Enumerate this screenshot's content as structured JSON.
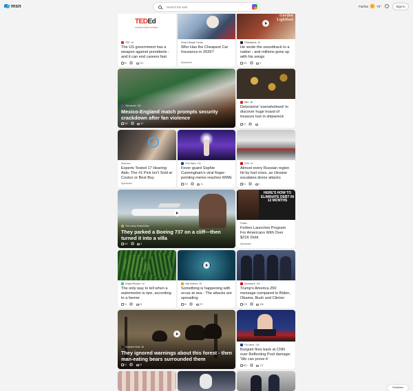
{
  "header": {
    "logo_text": "msn",
    "search_placeholder": "Search the web",
    "weather_city": "Fairfax",
    "weather_temp": "75°",
    "signin_label": "Sign in"
  },
  "feedback_label": "Feedback",
  "cards": [
    {
      "source": "TED",
      "time": "2d",
      "title": "The US government has a weapon against presidents - and it can end careers fast",
      "likes": "2K",
      "comments": "221"
    },
    {
      "source": "Smart Lifestyle Trends",
      "time": "",
      "title": "Who Has the Cheapest Car Insurance in 2026?",
      "sponsored": "Sponsored"
    },
    {
      "source": "Philadelphia",
      "time": "4h",
      "title": "He wrote the soundtrack to a nation - and millions grew up with his songs",
      "likes": "100",
      "comments": "9",
      "image_text": "Gordon Lightfoot"
    },
    {
      "source": "Telemundo",
      "time": "23h",
      "title": "Mexico-England match prompts security crackdown after fan violence",
      "likes": "289",
      "comments": "59"
    },
    {
      "source": "NBC",
      "time": "8h",
      "title": "Detectorist 'overwhelmed' to discover huge hoard of treasure lost in shipwreck",
      "likes": "21",
      "comments": ""
    },
    {
      "source": "Hear.com",
      "time": "",
      "title": "Experts Tested 17 Hearing Aids. The #1 Pick Isn't Sold at Costco or Best Buy",
      "sponsored": "Sponsored"
    },
    {
      "source": "FOX News",
      "time": "21h",
      "title": "Fever guard Sophie Cunningham's viral finger-pointing meme reaches WWE",
      "likes": "209",
      "comments": "11"
    },
    {
      "source": "CNN",
      "time": "1h",
      "title": "Almost every Russian region hit by fuel crisis, as Ukraine escalates drone attacks",
      "likes": "61",
      "comments": "3"
    },
    {
      "source": "The Luxury Pursuit Wow",
      "time": "",
      "title": "They parked a Boeing 737 on a cliff—then turned it into a villa",
      "likes": "264",
      "comments": "8"
    },
    {
      "source": "Forbes",
      "time": "",
      "title": "Forbes Launches Program For Americans With Over $21K Debt",
      "sponsored": "Sponsored",
      "image_text": "HERE'S HOW TO ELIMINATE DEBT IN 12 MONTHS"
    },
    {
      "source": "Simply Recipes",
      "time": "1d",
      "title": "The only way to tell when a watermelon is ripe, according to a farmer",
      "likes": "74",
      "comments": "28"
    },
    {
      "source": "Vast Science",
      "time": "3d",
      "title": "Something is happening with orcas at sea - The attacks are spreading",
      "likes": "4K",
      "comments": "577"
    },
    {
      "source": "Newsweek",
      "time": "10h",
      "title": "Trump's America 250 message compared to Biden, Obama, Bush and Clinton",
      "likes": "478",
      "comments": "336"
    },
    {
      "source": "Outdoors Guild",
      "time": "3d",
      "title": "They ignored warnings about this forest - then man-eating bears surrounded them",
      "likes": "41",
      "comments": "25"
    },
    {
      "source": "Fox News",
      "time": "13h",
      "title": "Burgum fires back at CNN over Reflecting Pool damage: 'We can prove it'",
      "likes": "803",
      "comments": "127"
    }
  ]
}
